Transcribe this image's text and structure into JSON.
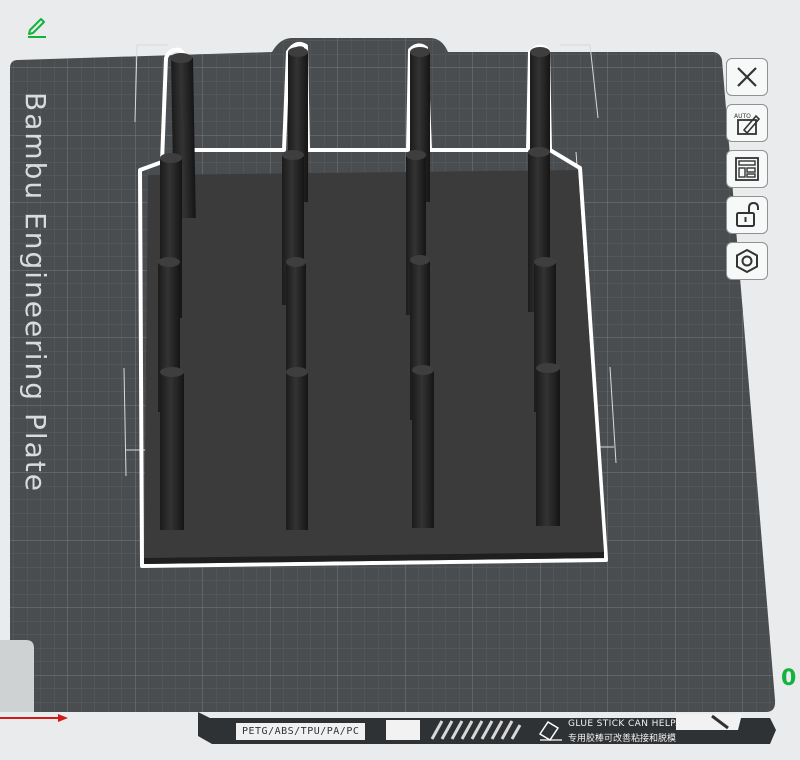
{
  "plate": {
    "name": "Bambu Engineering Plate",
    "filament_text": "PETG/ABS/TPU/PA/PC",
    "glue_text_en": "GLUE STICK CAN HELP.",
    "glue_text_cn": "专用胶棒可改善粘接和脱模"
  },
  "toolbar": {
    "items": [
      {
        "name": "close-tool-button",
        "icon": "x-icon"
      },
      {
        "name": "auto-orient-button",
        "icon": "auto-orient-icon",
        "label": "AUTO"
      },
      {
        "name": "arrange-button",
        "icon": "arrange-layout-icon"
      },
      {
        "name": "lock-plate-button",
        "icon": "unlocked-padlock-icon"
      },
      {
        "name": "plate-settings-button",
        "icon": "hexagon-nut-icon"
      }
    ]
  },
  "edit": {
    "icon": "pencil-edit-icon"
  },
  "axis": {
    "z_indicator": "0",
    "color": "#13b33c"
  },
  "colors": {
    "plate": "#4a4d4f",
    "grid": "#6b6f72",
    "model_base": "#3c3c3c",
    "pillar": "#2a2a2a",
    "selection_outline": "#ffffff"
  }
}
